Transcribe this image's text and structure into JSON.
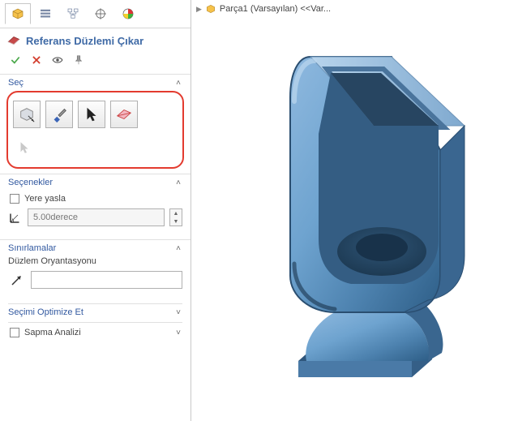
{
  "command": {
    "title": "Referans Düzlemi Çıkar"
  },
  "sections": {
    "sel": {
      "title": "Seç"
    },
    "opts": {
      "title": "Seçenekler",
      "snap_to_ground": "Yere yasla",
      "degree_value": "5.00derece"
    },
    "constraints": {
      "title": "Sınırlamalar",
      "plane_orientation": "Düzlem Oryantasyonu"
    },
    "optimize": {
      "title": "Seçimi Optimize Et"
    },
    "deviation": {
      "title": "Sapma Analizi"
    }
  },
  "breadcrumb": {
    "label": "Parça1 (Varsayılan) <<Var..."
  }
}
